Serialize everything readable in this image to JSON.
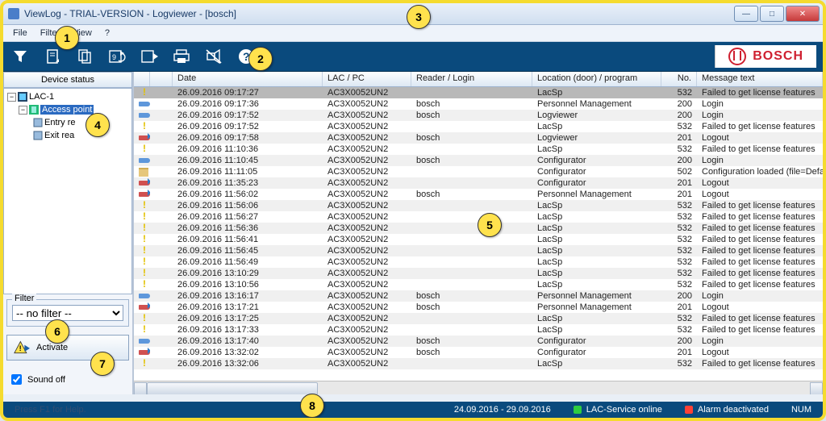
{
  "window": {
    "title": "ViewLog - TRIAL-VERSION - Logviewer - [bosch]"
  },
  "menu": [
    "File",
    "Filter",
    "View",
    "?"
  ],
  "brand": "BOSCH",
  "tree": {
    "header": "Device status",
    "root": "LAC-1",
    "selected": "Access point",
    "children": [
      "Entry re",
      "Exit rea"
    ]
  },
  "filter": {
    "legend": "Filter",
    "value": "-- no filter --"
  },
  "activate_label": "Activate",
  "sound_label": "Sound off",
  "columns": {
    "date": "Date",
    "lac": "LAC / PC",
    "reader": "Reader / Login",
    "loc": "Location (door) / program",
    "no": "No.",
    "msg": "Message text"
  },
  "rows": [
    {
      "icon": "warn",
      "date": "26.09.2016 09:17:27",
      "lac": "AC3X0052UN2",
      "reader": "",
      "loc": "LacSp",
      "no": 532,
      "msg": "Failed to get license features",
      "sel": true
    },
    {
      "icon": "key",
      "date": "26.09.2016 09:17:36",
      "lac": "AC3X0052UN2",
      "reader": "bosch",
      "loc": "Personnel Management",
      "no": 200,
      "msg": "Login"
    },
    {
      "icon": "key",
      "date": "26.09.2016 09:17:52",
      "lac": "AC3X0052UN2",
      "reader": "bosch",
      "loc": "Logviewer",
      "no": 200,
      "msg": "Login"
    },
    {
      "icon": "warn",
      "date": "26.09.2016 09:17:52",
      "lac": "AC3X0052UN2",
      "reader": "",
      "loc": "LacSp",
      "no": 532,
      "msg": "Failed to get license features"
    },
    {
      "icon": "keyout",
      "date": "26.09.2016 09:17:58",
      "lac": "AC3X0052UN2",
      "reader": "bosch",
      "loc": "Logviewer",
      "no": 201,
      "msg": "Logout"
    },
    {
      "icon": "warn",
      "date": "26.09.2016 11:10:36",
      "lac": "AC3X0052UN2",
      "reader": "",
      "loc": "LacSp",
      "no": 532,
      "msg": "Failed to get license features"
    },
    {
      "icon": "key",
      "date": "26.09.2016 11:10:45",
      "lac": "AC3X0052UN2",
      "reader": "bosch",
      "loc": "Configurator",
      "no": 200,
      "msg": "Login"
    },
    {
      "icon": "folder",
      "date": "26.09.2016 11:11:05",
      "lac": "AC3X0052UN2",
      "reader": "",
      "loc": "Configurator",
      "no": 502,
      "msg": "Configuration loaded (file=Default..."
    },
    {
      "icon": "keyout",
      "date": "26.09.2016 11:35:23",
      "lac": "AC3X0052UN2",
      "reader": "",
      "loc": "Configurator",
      "no": 201,
      "msg": "Logout"
    },
    {
      "icon": "keyout",
      "date": "26.09.2016 11:56:02",
      "lac": "AC3X0052UN2",
      "reader": "bosch",
      "loc": "Personnel Management",
      "no": 201,
      "msg": "Logout"
    },
    {
      "icon": "warn",
      "date": "26.09.2016 11:56:06",
      "lac": "AC3X0052UN2",
      "reader": "",
      "loc": "LacSp",
      "no": 532,
      "msg": "Failed to get license features"
    },
    {
      "icon": "warn",
      "date": "26.09.2016 11:56:27",
      "lac": "AC3X0052UN2",
      "reader": "",
      "loc": "LacSp",
      "no": 532,
      "msg": "Failed to get license features"
    },
    {
      "icon": "warn",
      "date": "26.09.2016 11:56:36",
      "lac": "AC3X0052UN2",
      "reader": "",
      "loc": "LacSp",
      "no": 532,
      "msg": "Failed to get license features"
    },
    {
      "icon": "warn",
      "date": "26.09.2016 11:56:41",
      "lac": "AC3X0052UN2",
      "reader": "",
      "loc": "LacSp",
      "no": 532,
      "msg": "Failed to get license features"
    },
    {
      "icon": "warn",
      "date": "26.09.2016 11:56:45",
      "lac": "AC3X0052UN2",
      "reader": "",
      "loc": "LacSp",
      "no": 532,
      "msg": "Failed to get license features"
    },
    {
      "icon": "warn",
      "date": "26.09.2016 11:56:49",
      "lac": "AC3X0052UN2",
      "reader": "",
      "loc": "LacSp",
      "no": 532,
      "msg": "Failed to get license features"
    },
    {
      "icon": "warn",
      "date": "26.09.2016 13:10:29",
      "lac": "AC3X0052UN2",
      "reader": "",
      "loc": "LacSp",
      "no": 532,
      "msg": "Failed to get license features"
    },
    {
      "icon": "warn",
      "date": "26.09.2016 13:10:56",
      "lac": "AC3X0052UN2",
      "reader": "",
      "loc": "LacSp",
      "no": 532,
      "msg": "Failed to get license features"
    },
    {
      "icon": "key",
      "date": "26.09.2016 13:16:17",
      "lac": "AC3X0052UN2",
      "reader": "bosch",
      "loc": "Personnel Management",
      "no": 200,
      "msg": "Login"
    },
    {
      "icon": "keyout",
      "date": "26.09.2016 13:17:21",
      "lac": "AC3X0052UN2",
      "reader": "bosch",
      "loc": "Personnel Management",
      "no": 201,
      "msg": "Logout"
    },
    {
      "icon": "warn",
      "date": "26.09.2016 13:17:25",
      "lac": "AC3X0052UN2",
      "reader": "",
      "loc": "LacSp",
      "no": 532,
      "msg": "Failed to get license features"
    },
    {
      "icon": "warn",
      "date": "26.09.2016 13:17:33",
      "lac": "AC3X0052UN2",
      "reader": "",
      "loc": "LacSp",
      "no": 532,
      "msg": "Failed to get license features"
    },
    {
      "icon": "key",
      "date": "26.09.2016 13:17:40",
      "lac": "AC3X0052UN2",
      "reader": "bosch",
      "loc": "Configurator",
      "no": 200,
      "msg": "Login"
    },
    {
      "icon": "keyout",
      "date": "26.09.2016 13:32:02",
      "lac": "AC3X0052UN2",
      "reader": "bosch",
      "loc": "Configurator",
      "no": 201,
      "msg": "Logout"
    },
    {
      "icon": "warn",
      "date": "26.09.2016 13:32:06",
      "lac": "AC3X0052UN2",
      "reader": "",
      "loc": "LacSp",
      "no": 532,
      "msg": "Failed to get license features"
    }
  ],
  "status": {
    "help": "Press F1 for Help.",
    "range": "24.09.2016 - 29.09.2016",
    "service": "LAC-Service online",
    "alarm": "Alarm deactivated",
    "num": "NUM"
  },
  "callouts": [
    "1",
    "2",
    "3",
    "4",
    "5",
    "6",
    "7",
    "8"
  ]
}
